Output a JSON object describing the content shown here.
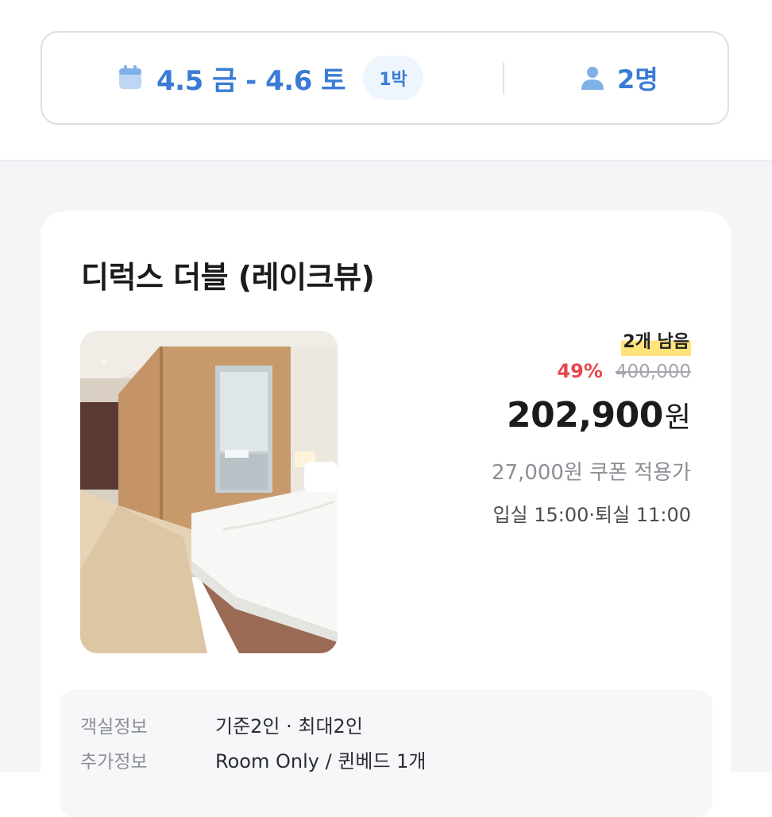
{
  "search_bar": {
    "date_range": "4.5 금 - 4.6 토",
    "nights": "1박",
    "guests": "2명",
    "calendar_icon": "calendar-icon",
    "person_icon": "person-icon",
    "accent_color": "#3a7bd5"
  },
  "room": {
    "title": "디럭스 더블 (레이크뷰)",
    "photo": "hotel-room-photo",
    "stock_label": "2개 남음",
    "discount_rate": "49%",
    "original_price": "400,000",
    "price": "202,900",
    "currency": "원",
    "coupon_note": "27,000원 쿠폰 적용가",
    "checkin_checkout": "입실 15:00·퇴실 11:00",
    "info": [
      {
        "label": "객실정보",
        "value": "기준2인 · 최대2인"
      },
      {
        "label": "추가정보",
        "value": "Room Only /  퀸베드 1개"
      }
    ]
  }
}
